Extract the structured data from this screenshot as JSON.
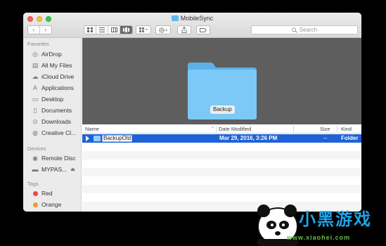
{
  "window": {
    "title": "MobileSync"
  },
  "toolbar": {
    "back": "‹",
    "forward": "›",
    "search_placeholder": "Search"
  },
  "sidebar": {
    "favorites_header": "Favorites",
    "favorites": [
      {
        "label": "AirDrop",
        "icon": "airdrop-icon"
      },
      {
        "label": "All My Files",
        "icon": "all-files-icon"
      },
      {
        "label": "iCloud Drive",
        "icon": "cloud-icon"
      },
      {
        "label": "Applications",
        "icon": "applications-icon"
      },
      {
        "label": "Desktop",
        "icon": "desktop-icon"
      },
      {
        "label": "Documents",
        "icon": "documents-icon"
      },
      {
        "label": "Downloads",
        "icon": "downloads-icon"
      },
      {
        "label": "Creative Cl...",
        "icon": "creative-cloud-icon"
      }
    ],
    "devices_header": "Devices",
    "devices": [
      {
        "label": "Remote Disc",
        "icon": "disc-icon"
      },
      {
        "label": "MYPAS...",
        "icon": "drive-icon"
      }
    ],
    "tags_header": "Tags",
    "tags": [
      {
        "label": "Red",
        "color": "#f2453d"
      },
      {
        "label": "Orange",
        "color": "#f39a2b"
      }
    ]
  },
  "preview": {
    "folder_label": "Backup"
  },
  "list": {
    "columns": {
      "name": "Name",
      "date": "Date Modified",
      "size": "Size",
      "kind": "Kind"
    },
    "rows": [
      {
        "name": "BackupOld",
        "date": "Mar 29, 2016, 3:26 PM",
        "size": "--",
        "kind": "Folder"
      }
    ]
  },
  "watermark": {
    "text": "小黑游戏",
    "url": "www.xiaohei.com"
  },
  "colors": {
    "selection": "#1f62d5",
    "folder": "#5fb8f0"
  }
}
